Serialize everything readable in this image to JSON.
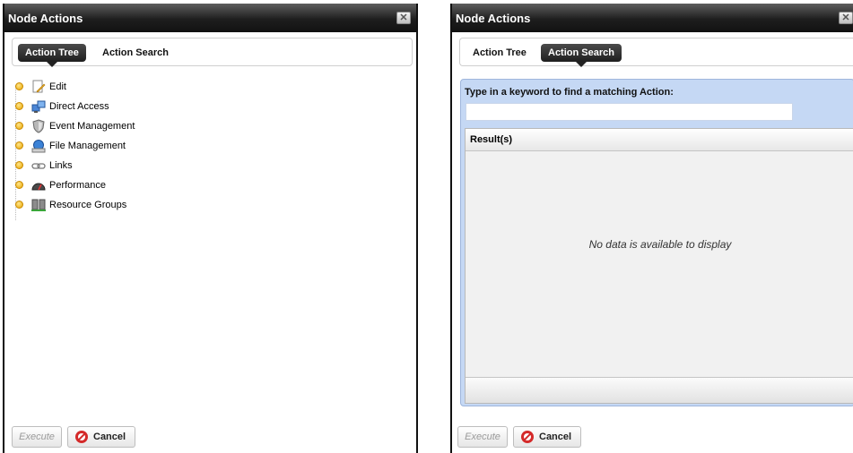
{
  "left_dialog": {
    "title": "Node Actions",
    "close_glyph": "✕",
    "tabs": [
      {
        "label": "Action Tree",
        "active": true
      },
      {
        "label": "Action Search",
        "active": false
      }
    ],
    "tree": [
      {
        "label": "Edit",
        "icon": "edit-document-icon"
      },
      {
        "label": "Direct Access",
        "icon": "direct-access-icon"
      },
      {
        "label": "Event Management",
        "icon": "shield-icon"
      },
      {
        "label": "File Management",
        "icon": "file-management-icon"
      },
      {
        "label": "Links",
        "icon": "chain-link-icon"
      },
      {
        "label": "Performance",
        "icon": "gauge-icon"
      },
      {
        "label": "Resource Groups",
        "icon": "server-group-icon"
      }
    ],
    "execute_label": "Execute",
    "cancel_label": "Cancel"
  },
  "right_dialog": {
    "title": "Node Actions",
    "close_glyph": "✕",
    "tabs": [
      {
        "label": "Action Tree",
        "active": false
      },
      {
        "label": "Action Search",
        "active": true
      }
    ],
    "search_label": "Type in a keyword to find a matching Action:",
    "search_value": "",
    "results_header": "Result(s)",
    "empty_message": "No data is available to display",
    "execute_label": "Execute",
    "cancel_label": "Cancel"
  },
  "colors": {
    "titlebar": "#1e1e1e",
    "search_panel": "#c5d8f4",
    "cancel_icon": "#d42a2a",
    "tree_bullet": "#e8a400"
  }
}
